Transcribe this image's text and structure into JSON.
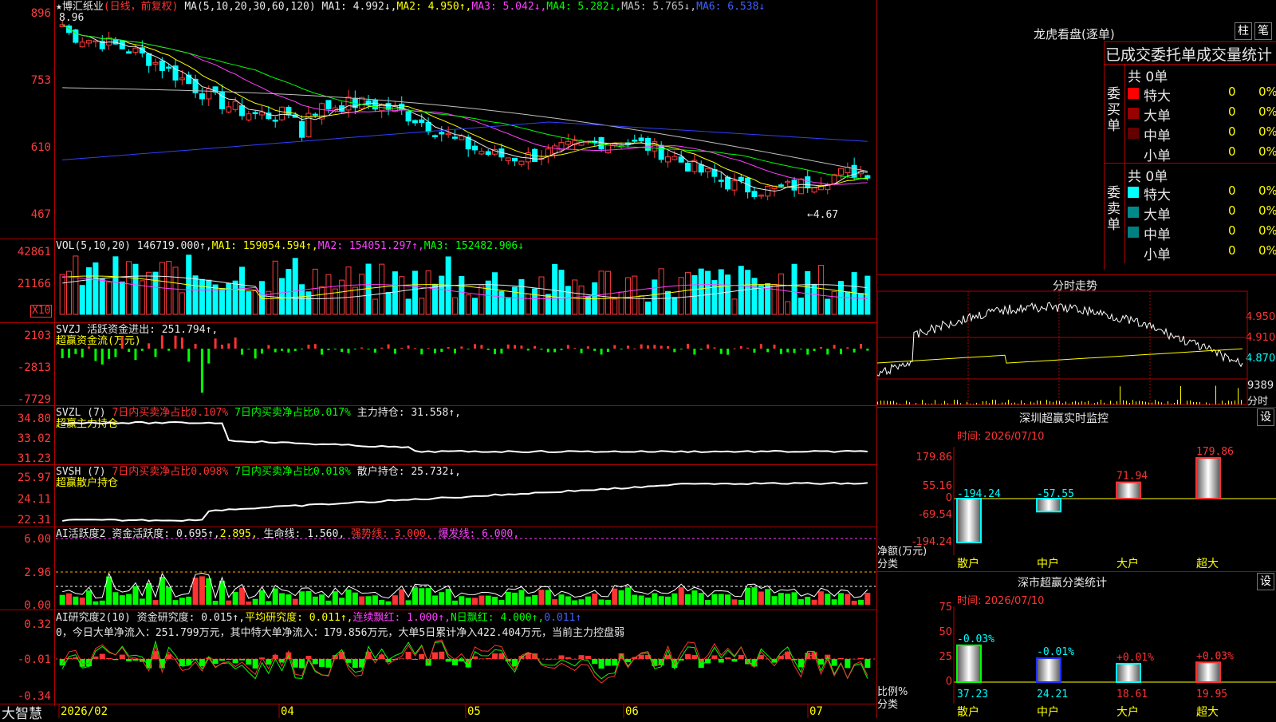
{
  "stock": {
    "star": "★",
    "name": "博汇纸业",
    "mode": "(日线，前复权)"
  },
  "price": {
    "axis": [
      "896",
      "753",
      "610",
      "467"
    ],
    "max_label": "8.96",
    "min_label": "←4.67",
    "ma_label": "MA(5,10,20,30,60,120)",
    "ma1": "MA1: 4.992↓,",
    "ma2": "MA2: 4.950↑,",
    "ma3": "MA3: 5.042↓,",
    "ma4": "MA4: 5.282↓,",
    "ma5": "MA5: 5.765↓,",
    "ma6": "MA6: 6.538↓"
  },
  "vol": {
    "axis": [
      "42861",
      "21166"
    ],
    "unit": "X10",
    "label": "VOL(5,10,20)",
    "value": "146719.000↑,",
    "ma1": "MA1: 159054.594↑,",
    "ma2": "MA2: 154051.297↑,",
    "ma3": "MA3: 152482.906↓"
  },
  "svzj": {
    "axis": [
      "2103",
      "-2813",
      "-7729"
    ],
    "label": "SVZJ  活跃资金进出: 251.794↑,",
    "sub": "超赢资金流(万元)"
  },
  "svzl": {
    "axis": [
      "34.80",
      "33.02",
      "31.23"
    ],
    "label": "SVZL (7)",
    "a": "7日内买卖净占比0.107%",
    "b": "7日内买卖净占比0.017%",
    "c": "主力持仓: 31.558↑,",
    "sub": "超赢主力持仓"
  },
  "svsh": {
    "axis": [
      "25.97",
      "24.11",
      "22.31"
    ],
    "label": "SVSH (7)",
    "a": "7日内买卖净占比0.098%",
    "b": "7日内买卖净占比0.018%",
    "c": "散户持仓: 25.732↓,",
    "sub": "超赢散户持仓"
  },
  "ai1": {
    "axis": [
      "6.00",
      "2.96",
      "0.00"
    ],
    "label": "AI活跃度2 资金活跃度: 0.695↑,",
    "v2": "2.895,",
    "v3": "生命线: 1.560,",
    "v4": "强势线: 3.000,",
    "v5": "爆发线: 6.000,"
  },
  "ai2": {
    "axis": [
      "0.32",
      "-0.01",
      "-0.34"
    ],
    "label": "AI研究度2(10) 资金研究度: 0.015↑,",
    "v2": "平均研究度: 0.011↑,",
    "v3": "连续飘红: 1.000↑,",
    "v4": "N日飘红: 4.000↑,",
    "v5": "0.011↑",
    "summary": "0，今日大单净流入：251.799万元，其中特大单净流入：179.856万元，大单5日累计净入422.404万元，当前主力控盘弱"
  },
  "dates": {
    "brand": "大智慧",
    "labels": [
      "2026/02",
      "04",
      "05",
      "06",
      "07"
    ]
  },
  "dragon": {
    "title": "龙虎看盘(逐单)",
    "btn1": "柱",
    "btn2": "笔",
    "subtitle": "已成交委托单成交量统计",
    "buy_label": "委买单",
    "buy_total": "共 0单",
    "buy_rows": [
      {
        "label": "特大",
        "v": "0",
        "p": "0%",
        "color": "#ff0000"
      },
      {
        "label": "大单",
        "v": "0",
        "p": "0%",
        "color": "#990000"
      },
      {
        "label": "中单",
        "v": "0",
        "p": "0%",
        "color": "#660000"
      },
      {
        "label": "小单",
        "v": "0",
        "p": "0%",
        "color": "#000000"
      }
    ],
    "sell_label": "委卖单",
    "sell_total": "共 0单",
    "sell_rows": [
      {
        "label": "特大",
        "v": "0",
        "p": "0%",
        "color": "#00ffff"
      },
      {
        "label": "大单",
        "v": "0",
        "p": "0%",
        "color": "#008a8a"
      },
      {
        "label": "中单",
        "v": "0",
        "p": "0%",
        "color": "#008080"
      },
      {
        "label": "小单",
        "v": "0",
        "p": "0%",
        "color": "#000000"
      }
    ]
  },
  "intraday": {
    "title": "分时走势",
    "axis": [
      "4.950",
      "4.910",
      "4.870"
    ],
    "vol": "9389",
    "vol_unit": "分时"
  },
  "monitor": {
    "title": "深圳超赢实时监控",
    "btn": "设",
    "time": "时间: 2026/07/10",
    "axis": [
      "179.86",
      "55.16",
      "0",
      "-69.54",
      "-194.24"
    ],
    "ylab1": "净额(万元)",
    "ylab2": "分类",
    "bars": [
      {
        "cat": "散户",
        "value": -194.24,
        "label": "-194.24"
      },
      {
        "cat": "中户",
        "value": -57.55,
        "label": "-57.55"
      },
      {
        "cat": "大户",
        "value": 71.94,
        "label": "71.94"
      },
      {
        "cat": "超大",
        "value": 179.86,
        "label": "179.86"
      }
    ]
  },
  "classify": {
    "title": "深市超赢分类统计",
    "btn": "设",
    "time": "时间: 2026/07/10",
    "axis": [
      "75",
      "50",
      "25",
      "0"
    ],
    "ylab1": "比例%",
    "ylab2": "分类",
    "bars": [
      {
        "cat": "散户",
        "value": 37.23,
        "label": "37.23",
        "change": "-0.03%"
      },
      {
        "cat": "中户",
        "value": 24.21,
        "label": "24.21",
        "change": "-0.01%"
      },
      {
        "cat": "大户",
        "value": 18.61,
        "label": "18.61",
        "change": "+0.01%"
      },
      {
        "cat": "超大",
        "value": 19.95,
        "label": "19.95",
        "change": "+0.03%"
      }
    ]
  }
}
